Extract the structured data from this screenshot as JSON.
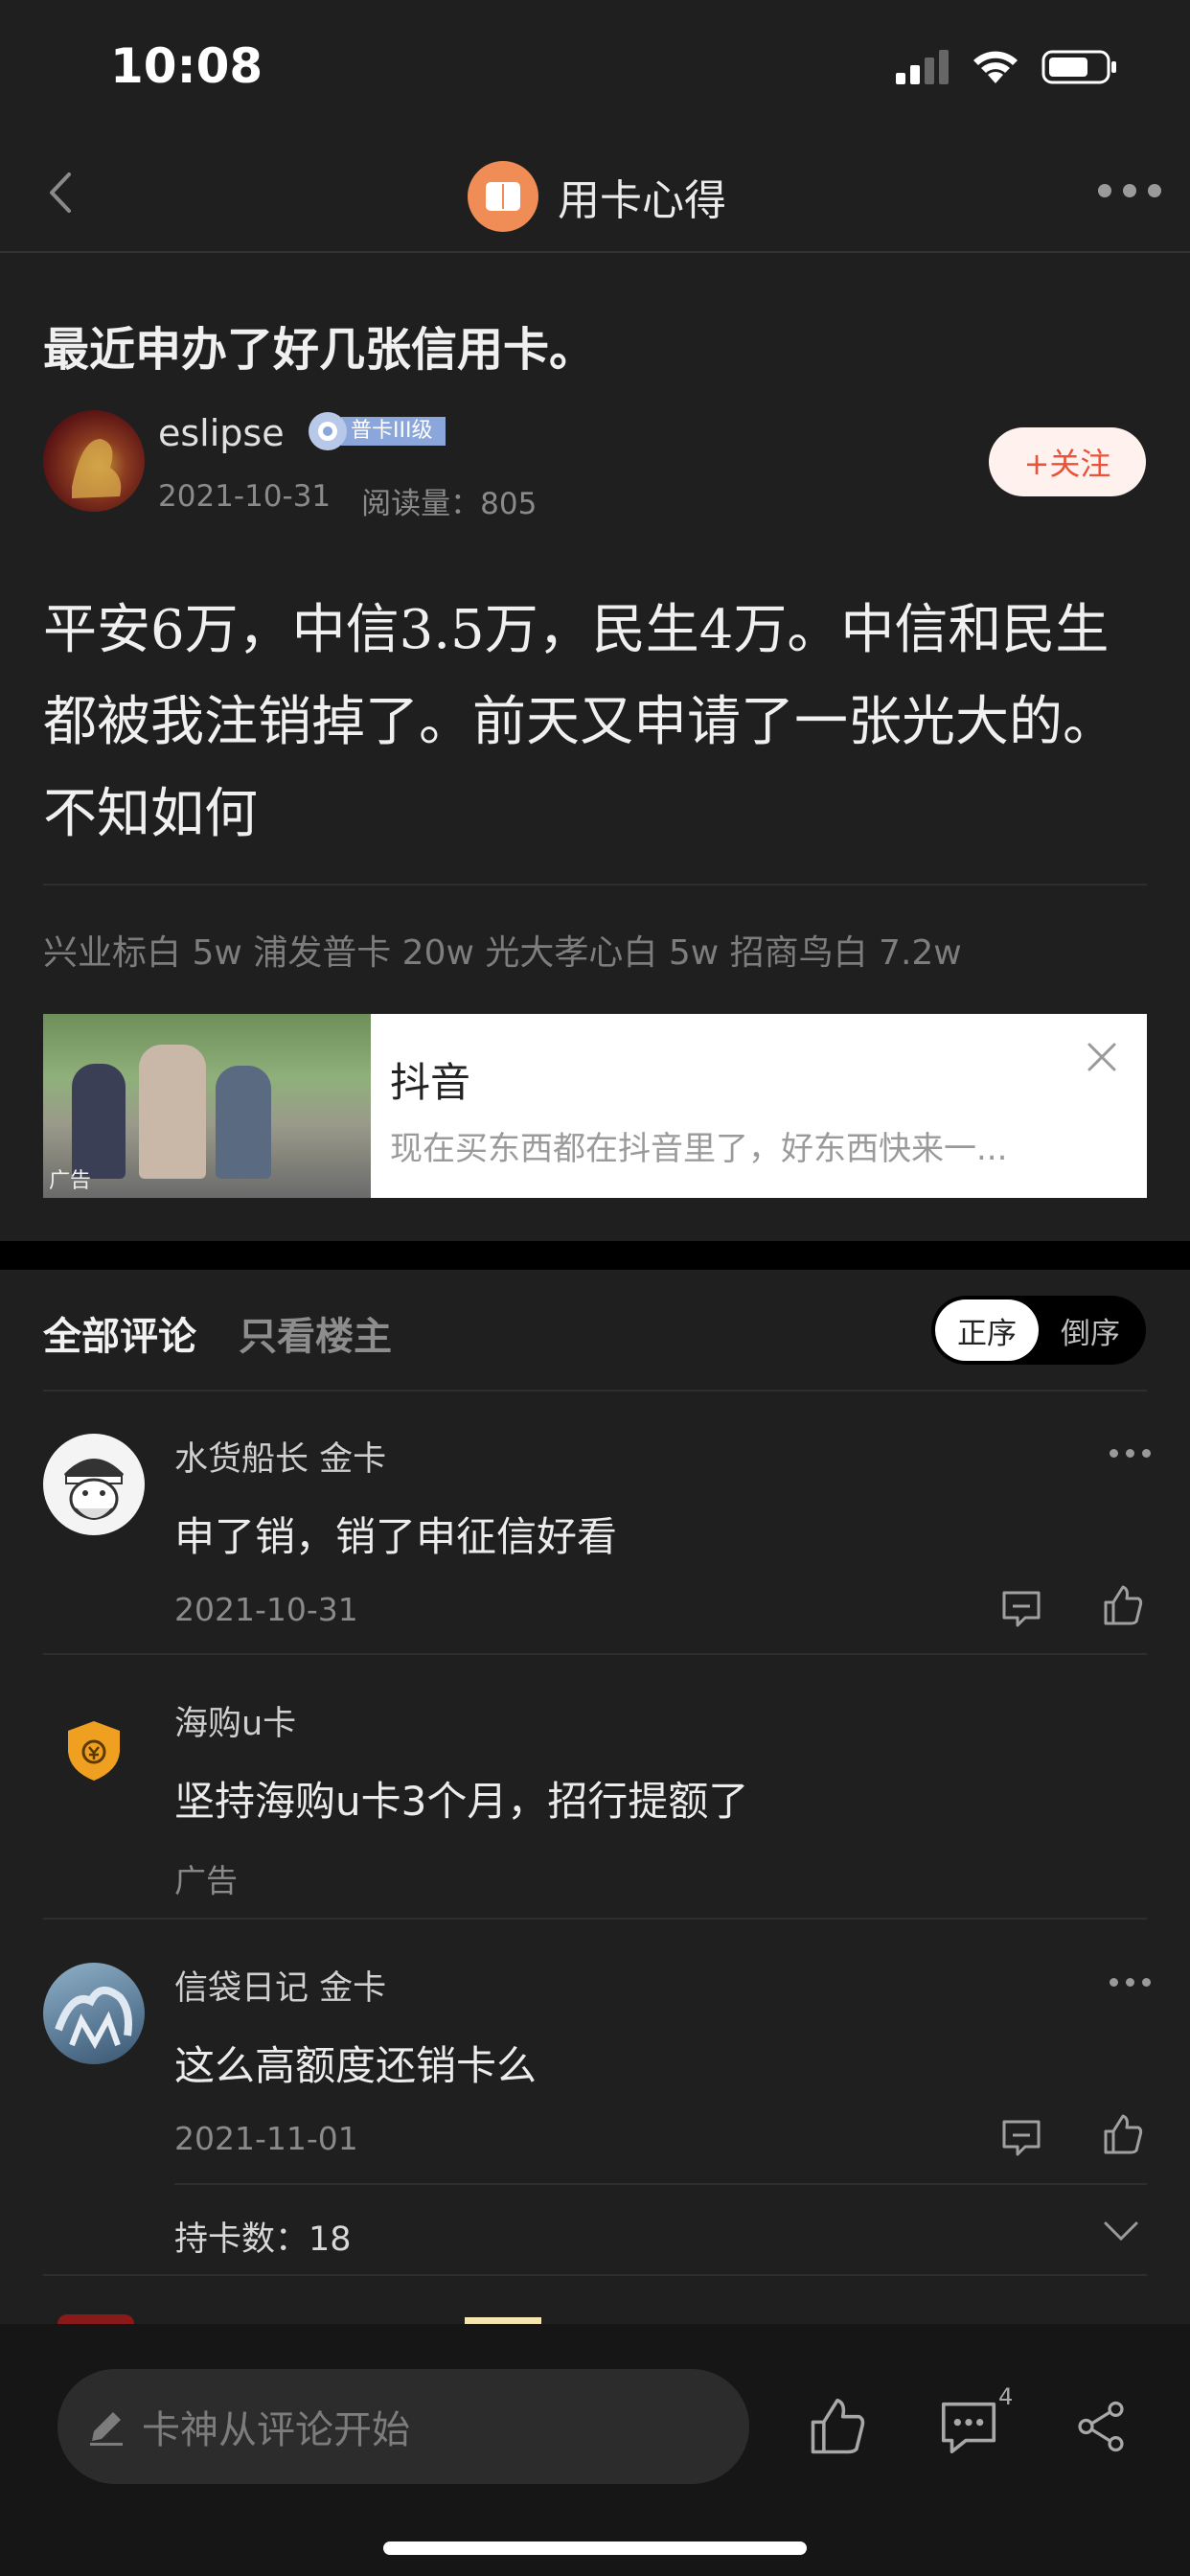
{
  "status_bar": {
    "time": "10:08"
  },
  "nav": {
    "title": "用卡心得"
  },
  "post": {
    "title": "最近申办了好几张信用卡。",
    "author": "eslipse",
    "badge": "普卡III级",
    "date": "2021-10-31",
    "views": "阅读量：805",
    "follow_label": "+关注",
    "body": "平安6万，中信3.5万，民生4万。中信和民生都被我注销掉了。前天又申请了一张光大的。不知如何",
    "tail": "兴业标白 5w 浦发普卡 20w 光大孝心白 5w 招商鸟白 7.2w"
  },
  "ad": {
    "title": "抖音",
    "desc": "现在买东西都在抖音里了，好东西快来一...",
    "img_label": "广告"
  },
  "comments_header": {
    "tab_all": "全部评论",
    "tab_op": "只看楼主",
    "order_asc": "正序",
    "order_desc": "倒序"
  },
  "comments": [
    {
      "name": "水货船长  金卡",
      "text": "申了销，销了申征信好看",
      "date": "2021-10-31"
    },
    {
      "name": "海购u卡",
      "text": "坚持海购u卡3个月，招行提额了",
      "date": "广告"
    },
    {
      "name": "信袋日记  金卡",
      "text": "这么高额度还销卡么",
      "date": "2021-11-01",
      "extra": "持卡数：18"
    }
  ],
  "bottom_bar": {
    "input_placeholder": "卡神从评论开始",
    "comment_count": "4"
  },
  "colors": {
    "accent_orange": "#f08c55",
    "follow_red": "#e8533a",
    "badge_blue": "#8aa6da",
    "background": "#1f1f1f"
  }
}
